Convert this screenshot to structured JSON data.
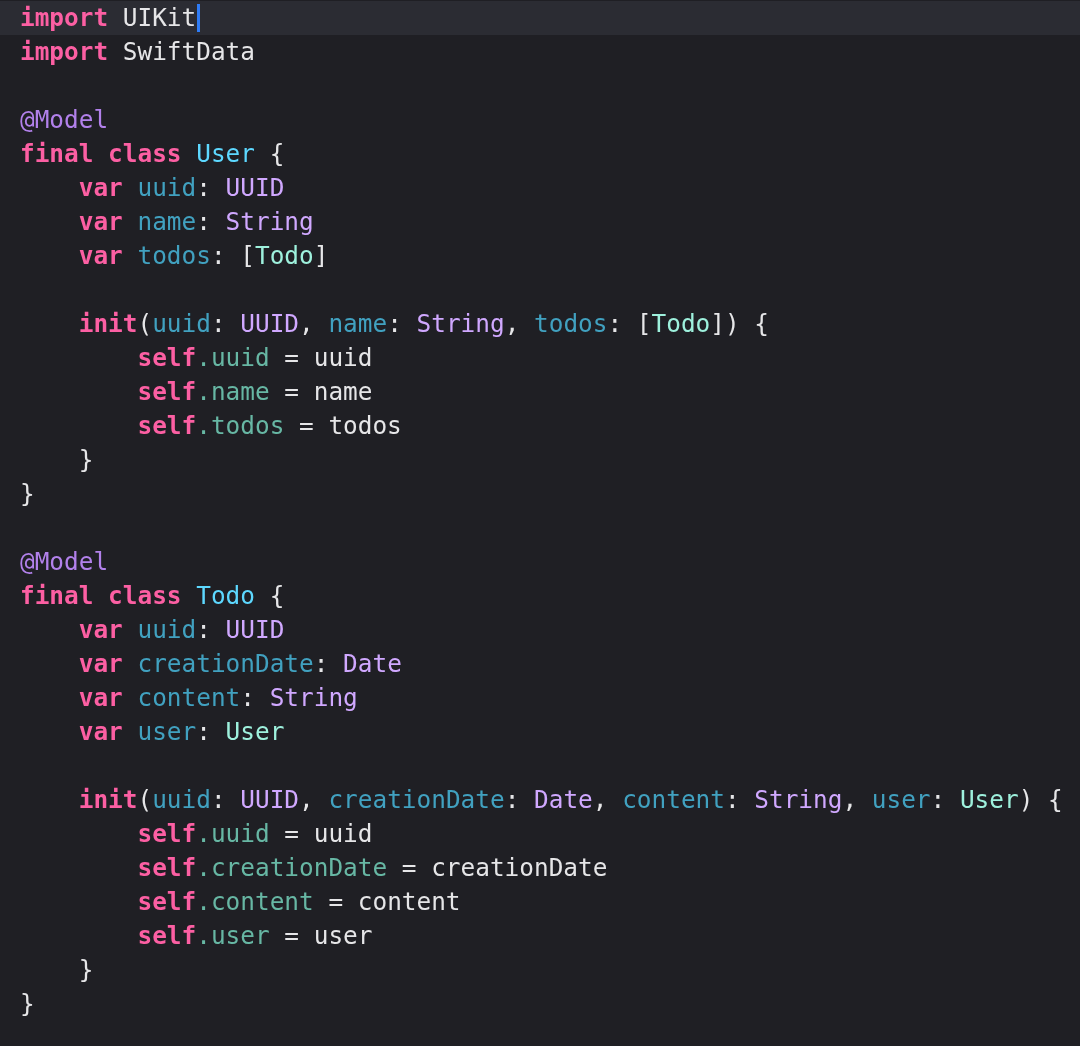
{
  "editor": {
    "lines": [
      {
        "kind": "code",
        "current": true,
        "cursor": true,
        "tokens": [
          {
            "text": "import",
            "kind": "keyword"
          },
          {
            "text": " UIKit",
            "kind": "plain"
          }
        ]
      },
      {
        "kind": "code",
        "current": false,
        "cursor": false,
        "tokens": [
          {
            "text": "import",
            "kind": "keyword"
          },
          {
            "text": " SwiftData",
            "kind": "plain"
          }
        ]
      },
      {
        "kind": "blank"
      },
      {
        "kind": "code",
        "current": false,
        "cursor": false,
        "tokens": [
          {
            "text": "@Model",
            "kind": "attribute"
          }
        ]
      },
      {
        "kind": "code",
        "current": false,
        "cursor": false,
        "tokens": [
          {
            "text": "final class ",
            "kind": "keyword"
          },
          {
            "text": "User",
            "kind": "type-decl"
          },
          {
            "text": " {",
            "kind": "plain"
          }
        ]
      },
      {
        "kind": "code",
        "current": false,
        "cursor": false,
        "tokens": [
          {
            "text": "    var ",
            "kind": "keyword"
          },
          {
            "text": "uuid",
            "kind": "prop-decl"
          },
          {
            "text": ": ",
            "kind": "plain"
          },
          {
            "text": "UUID",
            "kind": "system-type"
          }
        ]
      },
      {
        "kind": "code",
        "current": false,
        "cursor": false,
        "tokens": [
          {
            "text": "    var ",
            "kind": "keyword"
          },
          {
            "text": "name",
            "kind": "prop-decl"
          },
          {
            "text": ": ",
            "kind": "plain"
          },
          {
            "text": "String",
            "kind": "system-type"
          }
        ]
      },
      {
        "kind": "code",
        "current": false,
        "cursor": false,
        "tokens": [
          {
            "text": "    var ",
            "kind": "keyword"
          },
          {
            "text": "todos",
            "kind": "prop-decl"
          },
          {
            "text": ": [",
            "kind": "plain"
          },
          {
            "text": "Todo",
            "kind": "project-type"
          },
          {
            "text": "]",
            "kind": "plain"
          }
        ]
      },
      {
        "kind": "blank"
      },
      {
        "kind": "code",
        "current": false,
        "cursor": false,
        "tokens": [
          {
            "text": "    init",
            "kind": "keyword"
          },
          {
            "text": "(",
            "kind": "plain"
          },
          {
            "text": "uuid",
            "kind": "prop-decl"
          },
          {
            "text": ": ",
            "kind": "plain"
          },
          {
            "text": "UUID",
            "kind": "system-type"
          },
          {
            "text": ", ",
            "kind": "plain"
          },
          {
            "text": "name",
            "kind": "prop-decl"
          },
          {
            "text": ": ",
            "kind": "plain"
          },
          {
            "text": "String",
            "kind": "system-type"
          },
          {
            "text": ", ",
            "kind": "plain"
          },
          {
            "text": "todos",
            "kind": "prop-decl"
          },
          {
            "text": ": [",
            "kind": "plain"
          },
          {
            "text": "Todo",
            "kind": "project-type"
          },
          {
            "text": "]) {",
            "kind": "plain"
          }
        ]
      },
      {
        "kind": "code",
        "current": false,
        "cursor": false,
        "tokens": [
          {
            "text": "        self",
            "kind": "keyword"
          },
          {
            "text": ".uuid",
            "kind": "prop-ref"
          },
          {
            "text": " = uuid",
            "kind": "plain"
          }
        ]
      },
      {
        "kind": "code",
        "current": false,
        "cursor": false,
        "tokens": [
          {
            "text": "        self",
            "kind": "keyword"
          },
          {
            "text": ".name",
            "kind": "prop-ref"
          },
          {
            "text": " = name",
            "kind": "plain"
          }
        ]
      },
      {
        "kind": "code",
        "current": false,
        "cursor": false,
        "tokens": [
          {
            "text": "        self",
            "kind": "keyword"
          },
          {
            "text": ".todos",
            "kind": "prop-ref"
          },
          {
            "text": " = todos",
            "kind": "plain"
          }
        ]
      },
      {
        "kind": "code",
        "current": false,
        "cursor": false,
        "tokens": [
          {
            "text": "    }",
            "kind": "plain"
          }
        ]
      },
      {
        "kind": "code",
        "current": false,
        "cursor": false,
        "tokens": [
          {
            "text": "}",
            "kind": "plain"
          }
        ]
      },
      {
        "kind": "blank"
      },
      {
        "kind": "code",
        "current": false,
        "cursor": false,
        "tokens": [
          {
            "text": "@Model",
            "kind": "attribute"
          }
        ]
      },
      {
        "kind": "code",
        "current": false,
        "cursor": false,
        "tokens": [
          {
            "text": "final class ",
            "kind": "keyword"
          },
          {
            "text": "Todo",
            "kind": "type-decl"
          },
          {
            "text": " {",
            "kind": "plain"
          }
        ]
      },
      {
        "kind": "code",
        "current": false,
        "cursor": false,
        "tokens": [
          {
            "text": "    var ",
            "kind": "keyword"
          },
          {
            "text": "uuid",
            "kind": "prop-decl"
          },
          {
            "text": ": ",
            "kind": "plain"
          },
          {
            "text": "UUID",
            "kind": "system-type"
          }
        ]
      },
      {
        "kind": "code",
        "current": false,
        "cursor": false,
        "tokens": [
          {
            "text": "    var ",
            "kind": "keyword"
          },
          {
            "text": "creationDate",
            "kind": "prop-decl"
          },
          {
            "text": ": ",
            "kind": "plain"
          },
          {
            "text": "Date",
            "kind": "system-type"
          }
        ]
      },
      {
        "kind": "code",
        "current": false,
        "cursor": false,
        "tokens": [
          {
            "text": "    var ",
            "kind": "keyword"
          },
          {
            "text": "content",
            "kind": "prop-decl"
          },
          {
            "text": ": ",
            "kind": "plain"
          },
          {
            "text": "String",
            "kind": "system-type"
          }
        ]
      },
      {
        "kind": "code",
        "current": false,
        "cursor": false,
        "tokens": [
          {
            "text": "    var ",
            "kind": "keyword"
          },
          {
            "text": "user",
            "kind": "prop-decl"
          },
          {
            "text": ": ",
            "kind": "plain"
          },
          {
            "text": "User",
            "kind": "project-type"
          }
        ]
      },
      {
        "kind": "blank"
      },
      {
        "kind": "code",
        "current": false,
        "cursor": false,
        "tokens": [
          {
            "text": "    init",
            "kind": "keyword"
          },
          {
            "text": "(",
            "kind": "plain"
          },
          {
            "text": "uuid",
            "kind": "prop-decl"
          },
          {
            "text": ": ",
            "kind": "plain"
          },
          {
            "text": "UUID",
            "kind": "system-type"
          },
          {
            "text": ", ",
            "kind": "plain"
          },
          {
            "text": "creationDate",
            "kind": "prop-decl"
          },
          {
            "text": ": ",
            "kind": "plain"
          },
          {
            "text": "Date",
            "kind": "system-type"
          },
          {
            "text": ", ",
            "kind": "plain"
          },
          {
            "text": "content",
            "kind": "prop-decl"
          },
          {
            "text": ": ",
            "kind": "plain"
          },
          {
            "text": "String",
            "kind": "system-type"
          },
          {
            "text": ", ",
            "kind": "plain"
          },
          {
            "text": "user",
            "kind": "prop-decl"
          },
          {
            "text": ": ",
            "kind": "plain"
          },
          {
            "text": "User",
            "kind": "project-type"
          },
          {
            "text": ") {",
            "kind": "plain"
          }
        ]
      },
      {
        "kind": "code",
        "current": false,
        "cursor": false,
        "tokens": [
          {
            "text": "        self",
            "kind": "keyword"
          },
          {
            "text": ".uuid",
            "kind": "prop-ref"
          },
          {
            "text": " = uuid",
            "kind": "plain"
          }
        ]
      },
      {
        "kind": "code",
        "current": false,
        "cursor": false,
        "tokens": [
          {
            "text": "        self",
            "kind": "keyword"
          },
          {
            "text": ".creationDate",
            "kind": "prop-ref"
          },
          {
            "text": " = creationDate",
            "kind": "plain"
          }
        ]
      },
      {
        "kind": "code",
        "current": false,
        "cursor": false,
        "tokens": [
          {
            "text": "        self",
            "kind": "keyword"
          },
          {
            "text": ".content",
            "kind": "prop-ref"
          },
          {
            "text": " = content",
            "kind": "plain"
          }
        ]
      },
      {
        "kind": "code",
        "current": false,
        "cursor": false,
        "tokens": [
          {
            "text": "        self",
            "kind": "keyword"
          },
          {
            "text": ".user",
            "kind": "prop-ref"
          },
          {
            "text": " = user",
            "kind": "plain"
          }
        ]
      },
      {
        "kind": "code",
        "current": false,
        "cursor": false,
        "tokens": [
          {
            "text": "    }",
            "kind": "plain"
          }
        ]
      },
      {
        "kind": "code",
        "current": false,
        "cursor": false,
        "tokens": [
          {
            "text": "}",
            "kind": "plain"
          }
        ]
      }
    ]
  }
}
